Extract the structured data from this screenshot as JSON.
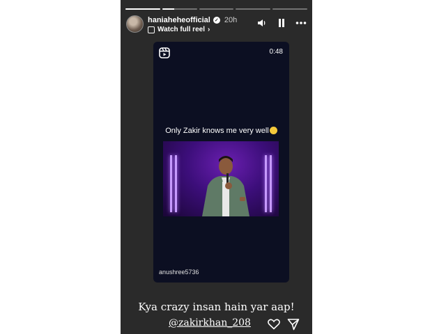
{
  "story": {
    "progress": [
      1,
      0.35,
      0,
      0,
      0
    ],
    "user": {
      "name": "haniaheheofficial",
      "time": "20h",
      "watch_label": "Watch full reel",
      "chevron": "›"
    },
    "icons": [
      "volume-icon",
      "pause-icon",
      "more-icon"
    ]
  },
  "reel": {
    "duration": "0:48",
    "caption": "Only Zakir knows me very well",
    "caption_emoji": "slightly-smiling-face",
    "watermark": "anushree5736"
  },
  "overlay": {
    "text": "Kya crazy insan hain yar aap!",
    "mention": "@zakirkhan_208"
  },
  "actions": [
    "heart-icon",
    "send-icon"
  ],
  "colors": {
    "story_bg": "#2a2a2a",
    "card_bg": "#0c0f22",
    "stage_purple": "#3c0e7a",
    "light": "#c79bff"
  }
}
